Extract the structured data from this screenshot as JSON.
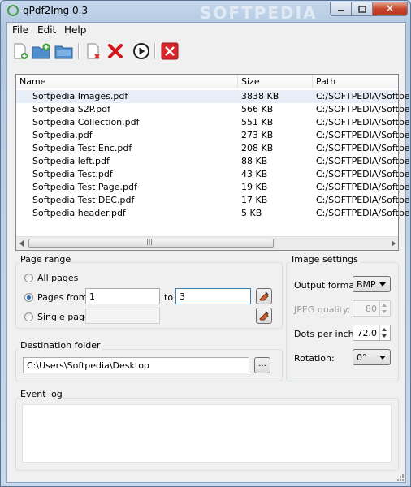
{
  "window": {
    "title": "qPdf2Img 0.3",
    "watermark": "SOFTPEDIA",
    "close_glyph": "✕"
  },
  "menu": [
    "File",
    "Edit",
    "Help"
  ],
  "toolbar": {
    "buttons": [
      {
        "name": "add-file-icon"
      },
      {
        "name": "add-folder-icon"
      },
      {
        "name": "open-folder-icon"
      },
      {
        "name": "remove-file-icon"
      },
      {
        "name": "remove-all-icon"
      },
      {
        "name": "convert-play-icon"
      },
      {
        "name": "exit-icon"
      }
    ]
  },
  "file_list": {
    "columns": [
      "Name",
      "Size",
      "Path"
    ],
    "rows": [
      {
        "name": "Softpedia Images.pdf",
        "size": "3838 KB",
        "path": "C:/SOFTPEDIA/Softpe"
      },
      {
        "name": "Softpedia S2P.pdf",
        "size": "566 KB",
        "path": "C:/SOFTPEDIA/Softpe"
      },
      {
        "name": "Softpedia Collection.pdf",
        "size": "551 KB",
        "path": "C:/SOFTPEDIA/Softpe"
      },
      {
        "name": "Softpedia.pdf",
        "size": "273 KB",
        "path": "C:/SOFTPEDIA/Softpe"
      },
      {
        "name": "Softpedia Test Enc.pdf",
        "size": "208 KB",
        "path": "C:/SOFTPEDIA/Softpe"
      },
      {
        "name": "Softpedia left.pdf",
        "size": "88 KB",
        "path": "C:/SOFTPEDIA/Softpe"
      },
      {
        "name": "Softpedia Test.pdf",
        "size": "43 KB",
        "path": "C:/SOFTPEDIA/Softpe"
      },
      {
        "name": "Softpedia Test Page.pdf",
        "size": "19 KB",
        "path": "C:/SOFTPEDIA/Softpe"
      },
      {
        "name": "Softpedia Test DEC.pdf",
        "size": "17 KB",
        "path": "C:/SOFTPEDIA/Softpe"
      },
      {
        "name": "Softpedia header.pdf",
        "size": "5 KB",
        "path": "C:/SOFTPEDIA/Softpe"
      }
    ],
    "scroll_grip": "|||"
  },
  "page_range": {
    "title": "Page range",
    "all_pages": "All pages",
    "pages_from": "Pages from",
    "from_value": "1",
    "to_label": "to",
    "to_value": "3",
    "single_page": "Single page",
    "single_value": ""
  },
  "destination": {
    "title": "Destination folder",
    "path": "C:\\Users\\Softpedia\\Desktop",
    "browse": "..."
  },
  "image_settings": {
    "title": "Image settings",
    "output_format_label": "Output format:",
    "output_format": "BMP",
    "jpeg_quality_label": "JPEG quality:",
    "jpeg_quality": "80",
    "dpi_label": "Dots per inch:",
    "dpi": "72.0",
    "rotation_label": "Rotation:",
    "rotation": "0°"
  },
  "event_log": {
    "title": "Event log"
  }
}
